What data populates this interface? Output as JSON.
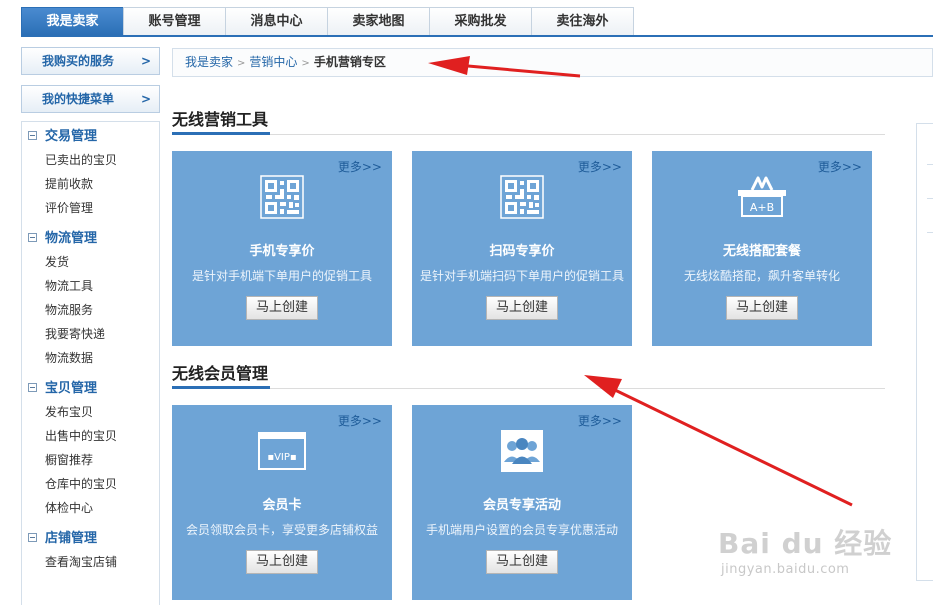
{
  "topnav": {
    "tabs": [
      "我是卖家",
      "账号管理",
      "消息中心",
      "卖家地图",
      "采购批发",
      "卖往海外"
    ],
    "active_index": 0
  },
  "sidebar": {
    "buttons": [
      {
        "label": "我购买的服务",
        "arrow": ">"
      },
      {
        "label": "我的快捷菜单",
        "arrow": ">"
      }
    ],
    "groups": [
      {
        "title": "交易管理",
        "items": [
          "已卖出的宝贝",
          "提前收款",
          "评价管理"
        ]
      },
      {
        "title": "物流管理",
        "items": [
          "发货",
          "物流工具",
          "物流服务",
          "我要寄快递",
          "物流数据"
        ]
      },
      {
        "title": "宝贝管理",
        "items": [
          "发布宝贝",
          "出售中的宝贝",
          "橱窗推荐",
          "仓库中的宝贝",
          "体检中心"
        ]
      },
      {
        "title": "店铺管理",
        "items": [
          "查看淘宝店铺"
        ]
      }
    ]
  },
  "breadcrumb": {
    "items": [
      "我是卖家",
      "营销中心"
    ],
    "separator": ">",
    "current": "手机营销专区"
  },
  "sections": [
    {
      "title": "无线营销工具",
      "cards": [
        {
          "icon": "qr-code-icon",
          "more": "更多>>",
          "title": "手机专享价",
          "desc": "是针对手机端下单用户的促销工具",
          "button": "马上创建"
        },
        {
          "icon": "qr-code-icon",
          "more": "更多>>",
          "title": "扫码专享价",
          "desc": "是针对手机端扫码下单用户的促销工具",
          "button": "马上创建"
        },
        {
          "icon": "combo-basket-icon",
          "icon_text": "A+B",
          "more": "更多>>",
          "title": "无线搭配套餐",
          "desc": "无线炫酷搭配，飙升客单转化",
          "button": "马上创建"
        }
      ]
    },
    {
      "title": "无线会员管理",
      "cards": [
        {
          "icon": "vip-card-icon",
          "icon_text": "▪VIP▪",
          "more": "更多>>",
          "title": "会员卡",
          "desc": "会员领取会员卡，享受更多店铺权益",
          "button": "马上创建"
        },
        {
          "icon": "members-group-icon",
          "more": "更多>>",
          "title": "会员专享活动",
          "desc": "手机端用户设置的会员专享优惠活动",
          "button": "马上创建"
        }
      ]
    }
  ],
  "watermark": {
    "logo": "Bai du 经验",
    "url": "jingyan.baidu.com"
  },
  "colors": {
    "accent": "#2b6fb6",
    "card": "#6ea4d6",
    "arrow": "#e02020",
    "link": "#2466a8"
  }
}
